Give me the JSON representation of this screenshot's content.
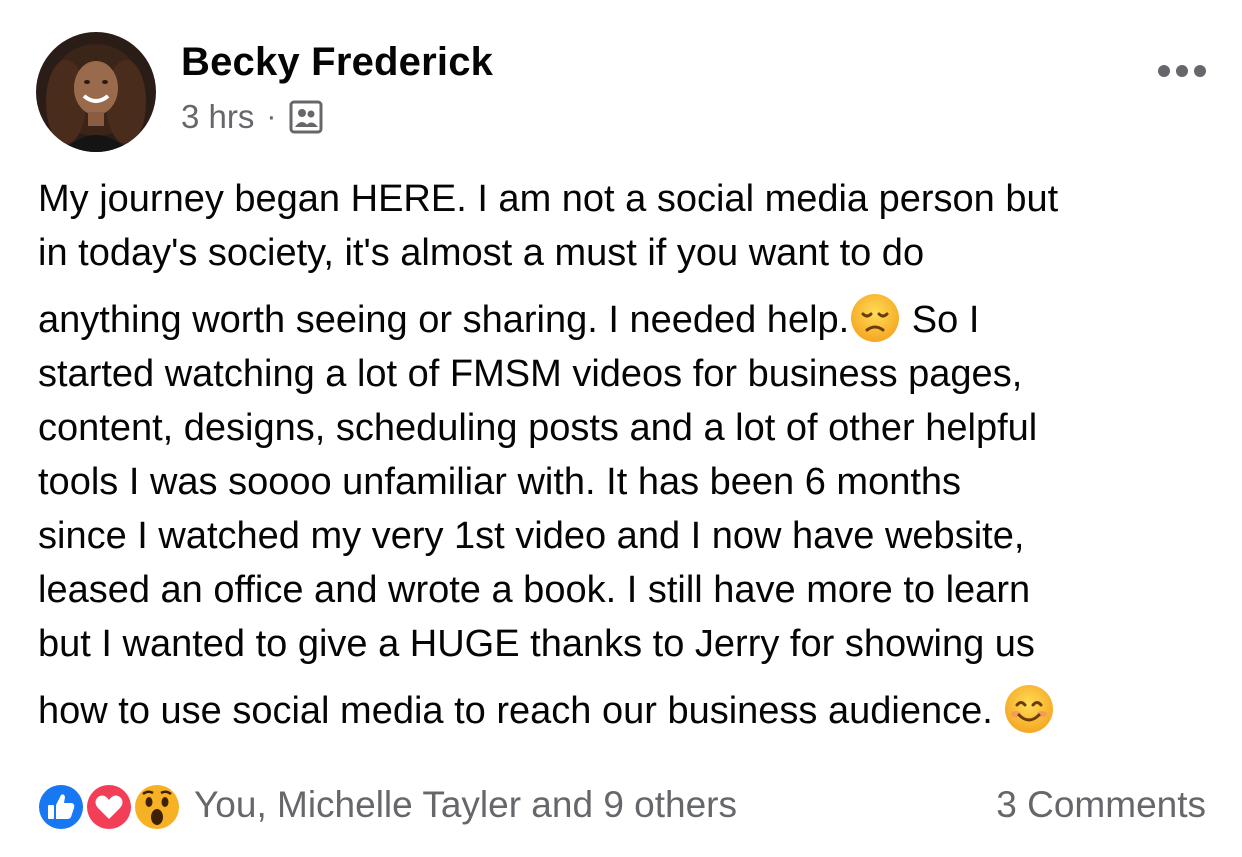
{
  "post": {
    "author": {
      "name": "Becky Frederick",
      "avatar_icon": "profile-photo"
    },
    "meta": {
      "time": "3 hrs",
      "separator": "·",
      "audience_icon": "group-members-icon"
    },
    "more_icon": "more-options-icon",
    "text_lines": [
      "My journey began HERE. I am not a social media person but",
      "in today's society, it's almost a must if you want to do",
      "anything worth seeing or sharing. I needed help.",
      " So I",
      "started watching a lot of FMSM videos for business pages,",
      "content, designs, scheduling posts and a lot of other helpful",
      "tools I was soooo unfamiliar with. It has been 6 months",
      "since I watched my very 1st video and I now have website,",
      "leased an office and wrote a book. I still have more to learn",
      "but I wanted to give a HUGE thanks to Jerry for showing us",
      "how to use social media to reach our business audience. "
    ],
    "emojis": [
      "disappointed-face",
      "smiling-face-with-smiling-eyes"
    ]
  },
  "reactions": {
    "icons": [
      "like-icon",
      "love-icon",
      "wow-icon"
    ],
    "names": "You, Michelle Tayler and 9 others",
    "comments": "3 Comments"
  },
  "colors": {
    "text": "#050505",
    "secondary": "#65676b",
    "like": "#1877f2",
    "love": "#f33e58",
    "wow": "#f7b125"
  }
}
